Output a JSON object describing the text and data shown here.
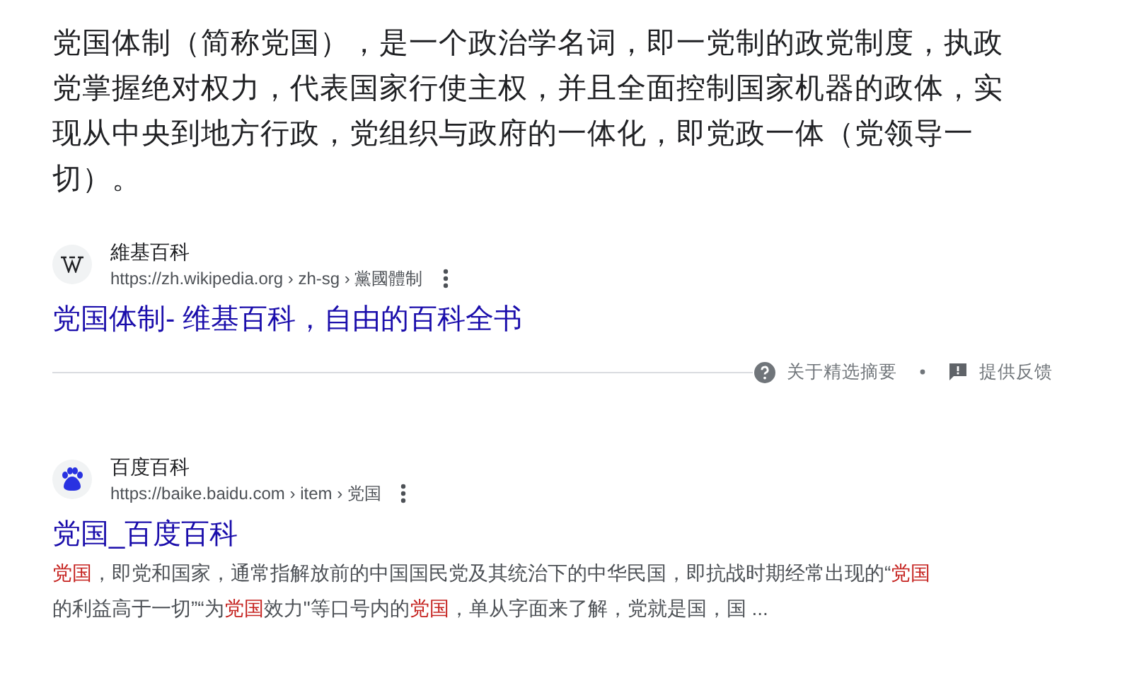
{
  "featured_snippet": {
    "text": "党国体制（简称党国），是一个政治学名词，即一党制的政党制度，执政党掌握绝对权力，代表国家行使主权，并且全面控制国家机器的政体，实现从中央到地方行政，党组织与政府的一体化，即党政一体（党领导一切）。"
  },
  "results": [
    {
      "kind": "wiki",
      "site": "維基百科",
      "url": "https://zh.wikipedia.org › zh-sg › 黨國體制",
      "title": "党国体制- 维基百科，自由的百科全书",
      "footer": {
        "about": "关于精选摘要",
        "feedback": "提供反馈"
      }
    },
    {
      "kind": "baidu",
      "site": "百度百科",
      "url": "https://baike.baidu.com › item › 党国",
      "title": "党国_百度百科",
      "snippet": [
        {
          "text": "党国",
          "highlight": true
        },
        {
          "text": "，即党和国家，通常指解放前的中国国民党及其统治下的中华民国，即抗战时期经常出现的“",
          "highlight": false
        },
        {
          "text": "党国",
          "highlight": true
        },
        {
          "text": "的利益高于一切”“为",
          "highlight": false
        },
        {
          "text": "党国",
          "highlight": true
        },
        {
          "text": "效力\"等口号内的",
          "highlight": false
        },
        {
          "text": "党国",
          "highlight": true
        },
        {
          "text": "，单从字面来了解，党就是国，国 ...",
          "highlight": false
        }
      ]
    }
  ]
}
